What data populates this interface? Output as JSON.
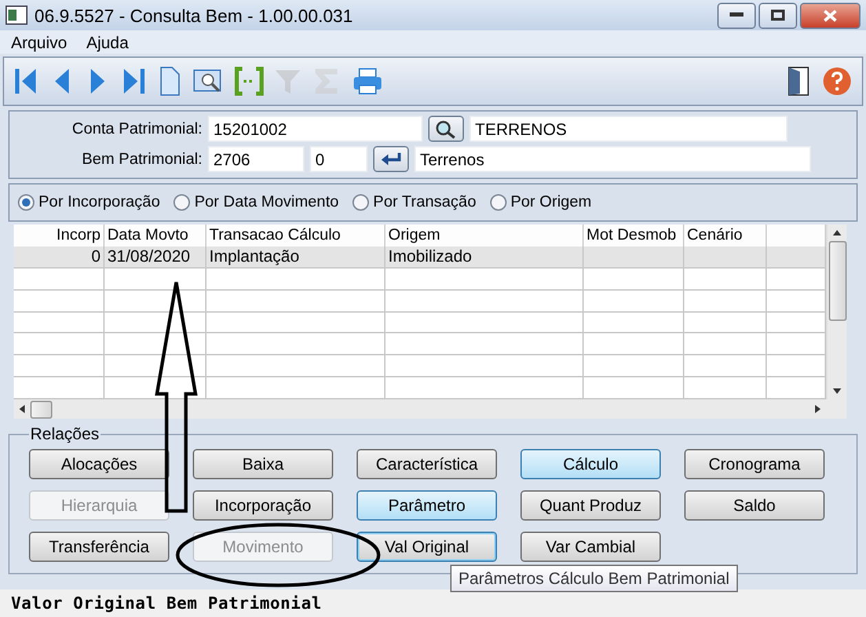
{
  "window": {
    "title": "06.9.5527 - Consulta Bem - 1.00.00.031"
  },
  "menu": [
    "Arquivo",
    "Ajuda"
  ],
  "toolbar": [
    {
      "kind": "first",
      "disabled": false
    },
    {
      "kind": "prev",
      "disabled": false
    },
    {
      "kind": "next",
      "disabled": false
    },
    {
      "kind": "last",
      "disabled": false
    },
    {
      "kind": "new",
      "disabled": false
    },
    {
      "kind": "preview",
      "disabled": false
    },
    {
      "kind": "goto",
      "disabled": false
    },
    {
      "kind": "filter",
      "disabled": true
    },
    {
      "kind": "sum",
      "disabled": true
    },
    {
      "kind": "print",
      "disabled": false
    }
  ],
  "toolbar_right": [
    {
      "kind": "exit"
    },
    {
      "kind": "help"
    }
  ],
  "form": {
    "conta": {
      "label": "Conta Patrimonial:",
      "value": "15201002",
      "description": "TERRENOS"
    },
    "bem": {
      "label": "Bem Patrimonial:",
      "value": "2706",
      "sequence": "0",
      "description": "Terrenos"
    }
  },
  "sort_options": [
    {
      "label": "Por Incorporação",
      "selected": true
    },
    {
      "label": "Por Data Movimento",
      "selected": false
    },
    {
      "label": "Por Transação",
      "selected": false
    },
    {
      "label": "Por Origem",
      "selected": false
    }
  ],
  "table": {
    "columns": [
      "Incorp",
      "Data Movto",
      "Transacao Cálculo",
      "Origem",
      "Mot Desmob",
      "Cenário"
    ],
    "rows": [
      {
        "cells": [
          "0",
          "31/08/2020",
          "Implantação",
          "Imobilizado",
          "",
          ""
        ],
        "selected": true
      }
    ]
  },
  "relations": {
    "title": "Relações",
    "buttons": [
      {
        "label": "Alocações",
        "disabled": false,
        "highlighted": false,
        "focused": false
      },
      {
        "label": "Baixa",
        "disabled": false,
        "highlighted": false,
        "focused": false
      },
      {
        "label": "Característica",
        "disabled": false,
        "highlighted": false,
        "focused": false
      },
      {
        "label": "Cálculo",
        "disabled": false,
        "highlighted": true,
        "focused": false
      },
      {
        "label": "Cronograma",
        "disabled": false,
        "highlighted": false,
        "focused": false
      },
      {
        "label": "Hierarquia",
        "disabled": true,
        "highlighted": false,
        "focused": false
      },
      {
        "label": "Incorporação",
        "disabled": false,
        "highlighted": false,
        "focused": false
      },
      {
        "label": "Parâmetro",
        "disabled": false,
        "highlighted": true,
        "focused": false
      },
      {
        "label": "Quant Produz",
        "disabled": false,
        "highlighted": false,
        "focused": false
      },
      {
        "label": "Saldo",
        "disabled": false,
        "highlighted": false,
        "focused": false
      },
      {
        "label": "Transferência",
        "disabled": false,
        "highlighted": false,
        "focused": false
      },
      {
        "label": "Movimento",
        "disabled": true,
        "highlighted": false,
        "focused": false
      },
      {
        "label": "Val Original",
        "disabled": false,
        "highlighted": false,
        "focused": true
      },
      {
        "label": "Var Cambial",
        "disabled": false,
        "highlighted": false,
        "focused": false
      }
    ]
  },
  "tooltip": "Parâmetros Cálculo Bem Patrimonial",
  "status_bar": "Valor Original Bem Patrimonial"
}
